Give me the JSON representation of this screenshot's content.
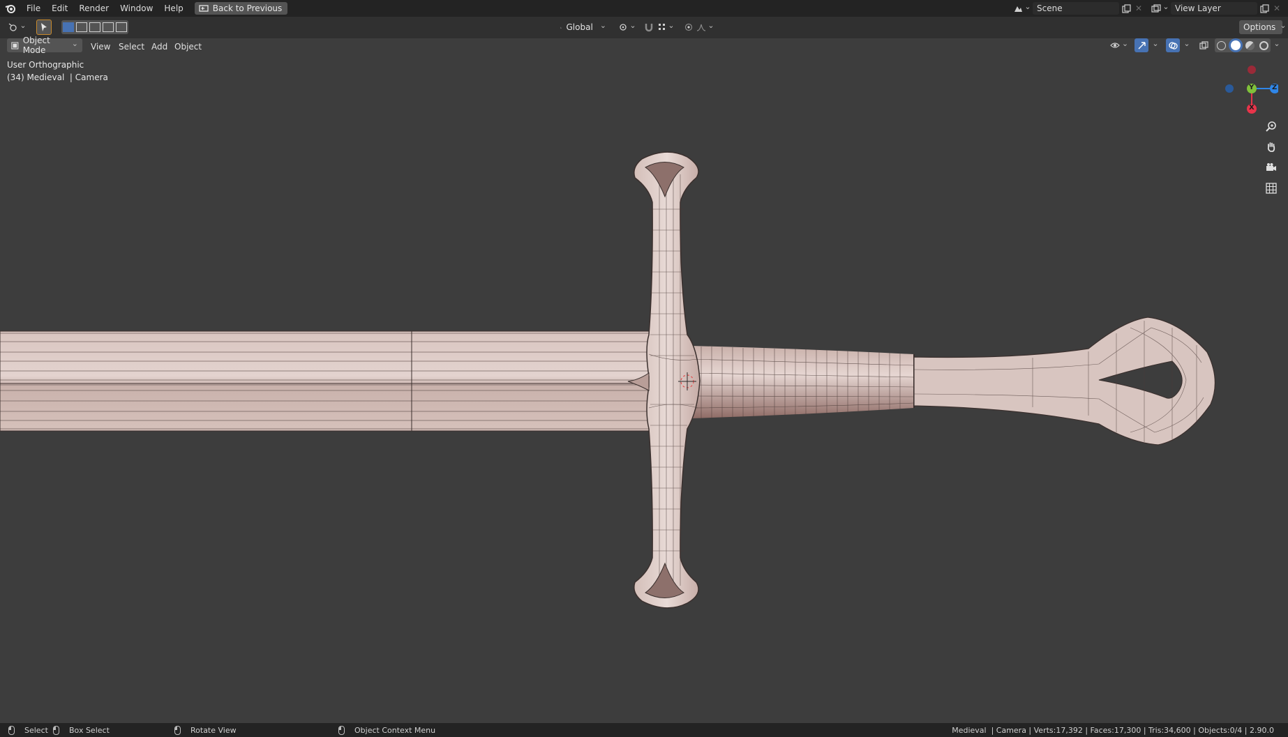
{
  "topbar": {
    "menu": [
      "File",
      "Edit",
      "Render",
      "Window",
      "Help"
    ],
    "back_button": "Back to Previous",
    "scene": "Scene",
    "view_layer": "View Layer"
  },
  "toolbar": {
    "transform_orientation": "Global",
    "options_label": "Options"
  },
  "header": {
    "mode": "Object Mode",
    "menus": [
      "View",
      "Select",
      "Add",
      "Object"
    ]
  },
  "viewport": {
    "view_name": "User Orthographic",
    "context": "(34) Medieval  | Camera",
    "gizmo_axes": {
      "x": "X",
      "y": "Y",
      "z": "Z"
    },
    "colors": {
      "background": "#3d3d3d",
      "mesh": "#d8c3bd",
      "x_axis": "#e8344a",
      "y_axis": "#80c13a",
      "z_axis": "#2f86e8"
    }
  },
  "statusbar": {
    "select": "Select",
    "box_select": "Box Select",
    "rotate_view": "Rotate View",
    "context_menu": "Object Context Menu",
    "stats": "Medieval  | Camera | Verts:17,392 | Faces:17,300 | Tris:34,600 | Objects:0/4 | 2.90.0"
  }
}
